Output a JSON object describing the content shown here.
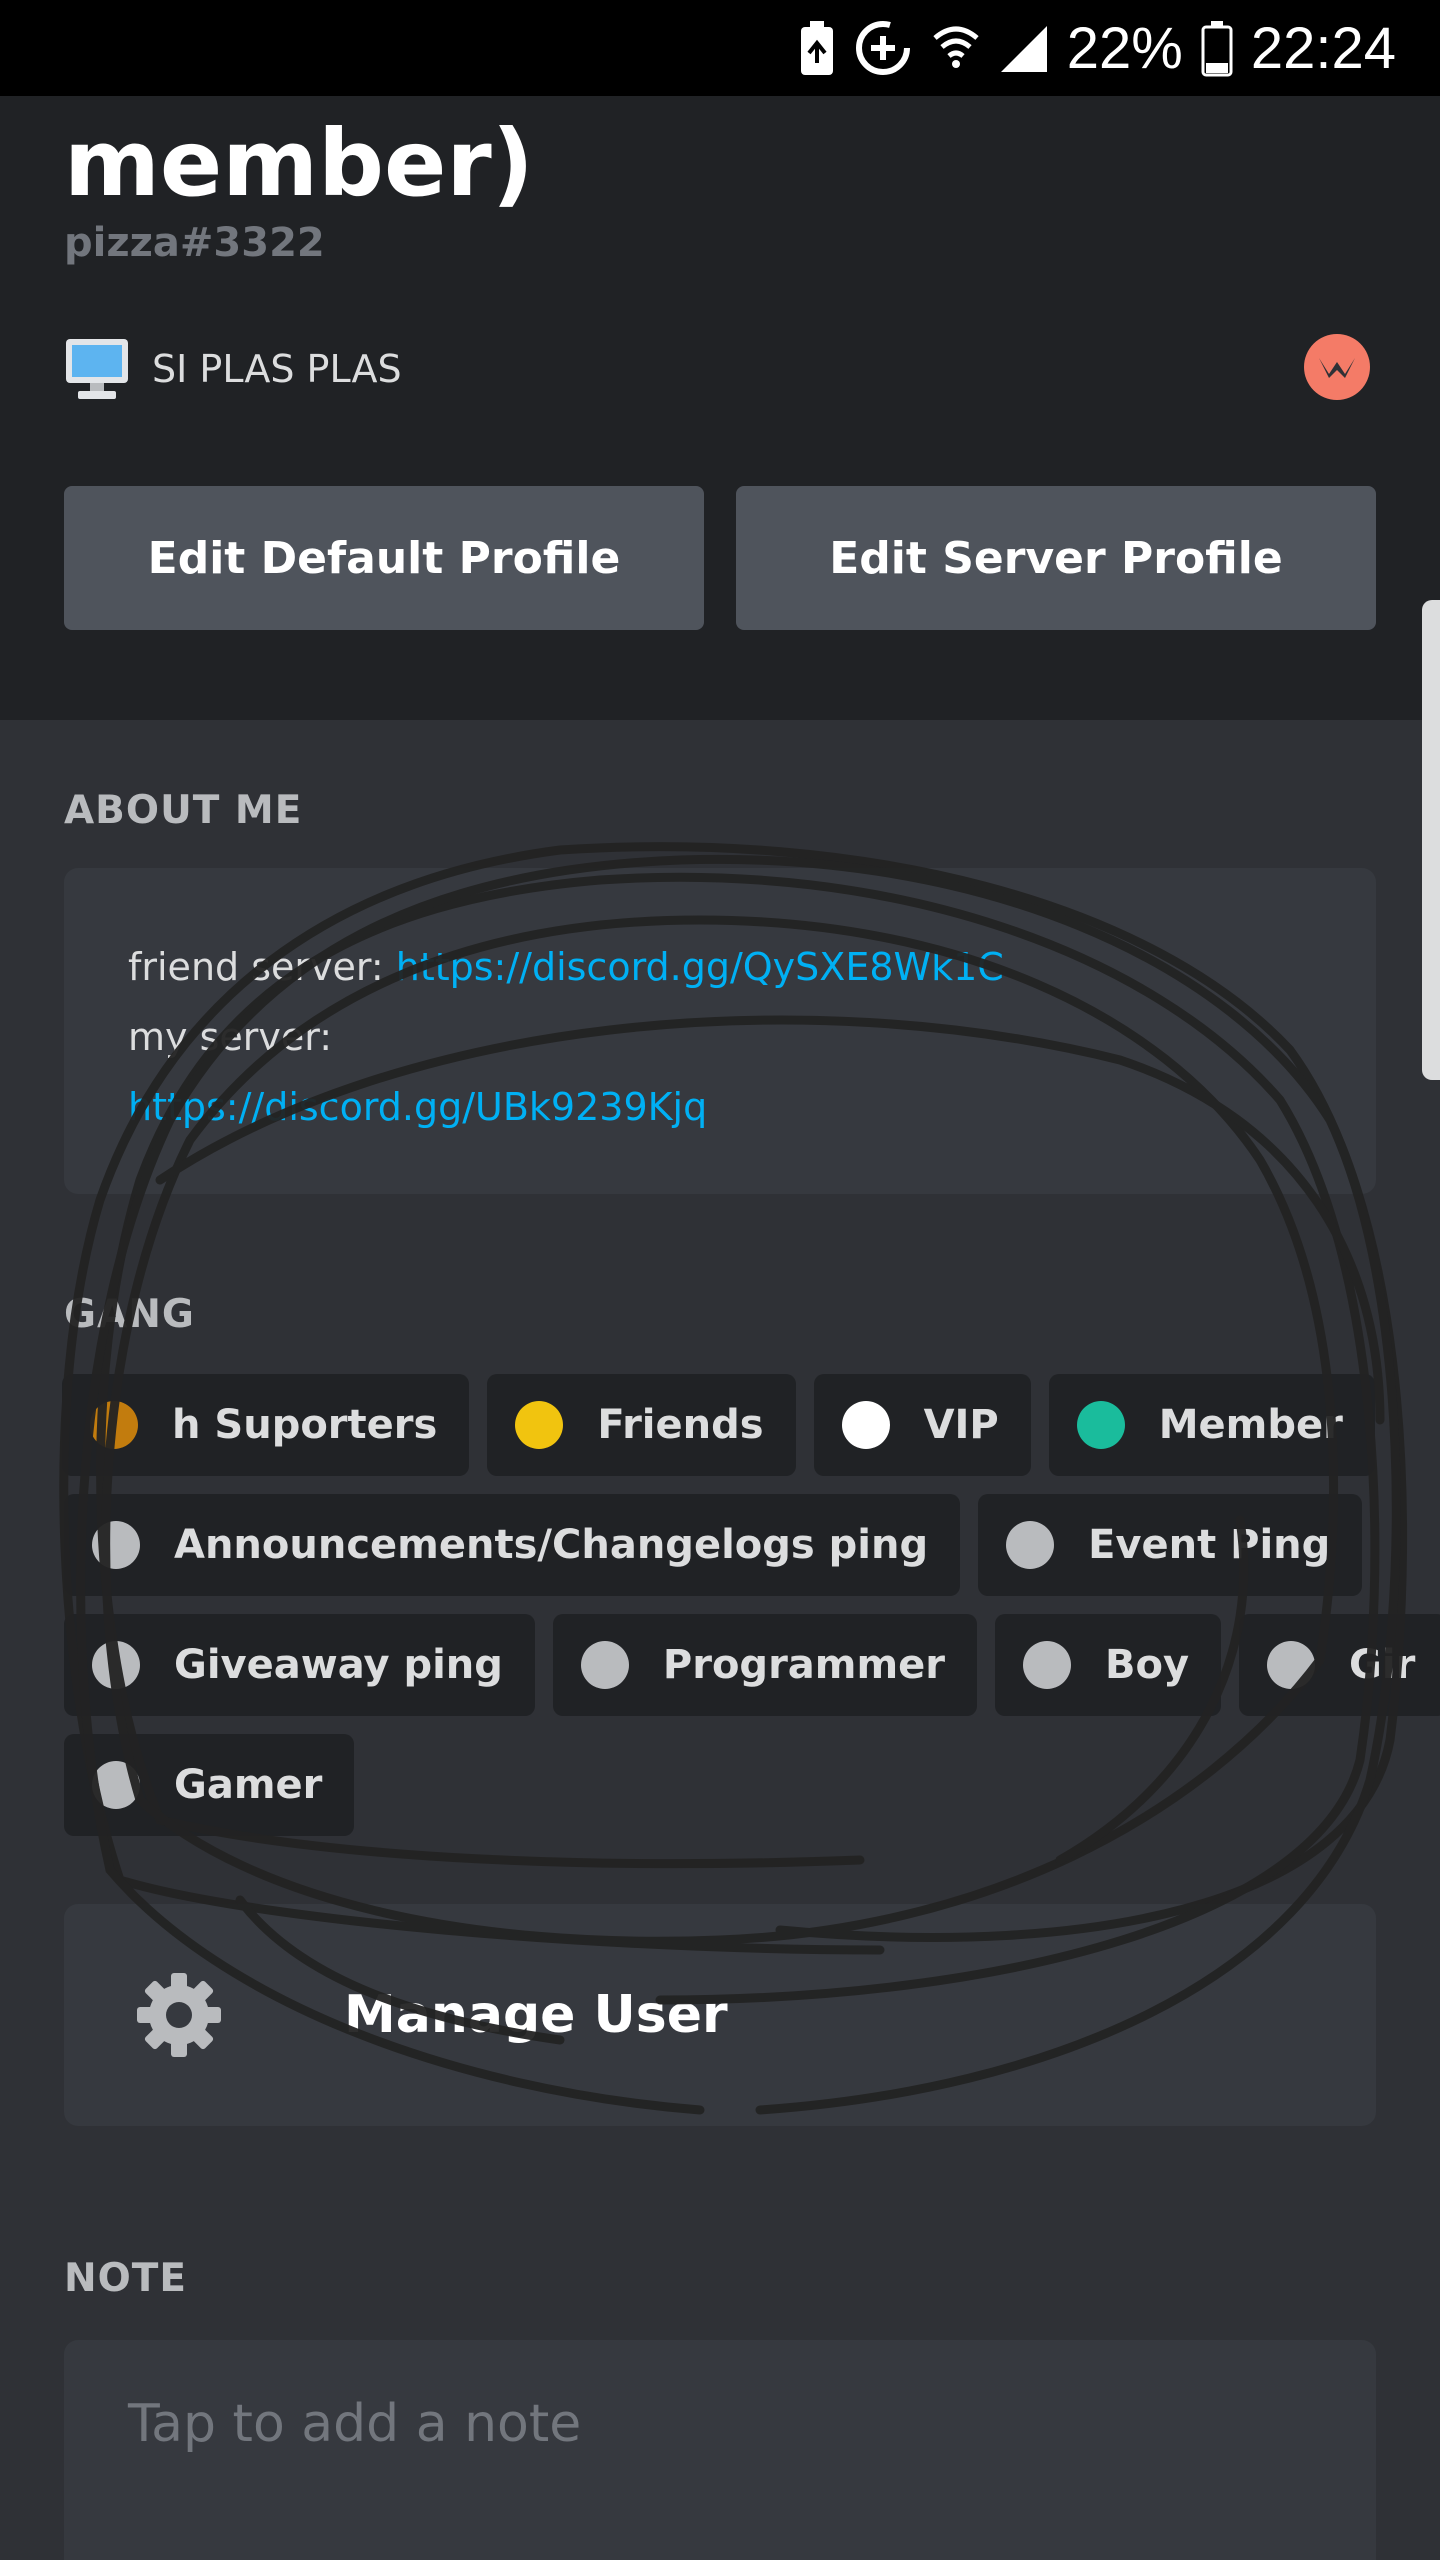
{
  "status_bar": {
    "battery_percent": "22%",
    "time": "22:24",
    "icons": [
      "battery-saver-icon",
      "data-saver-icon",
      "wifi-icon",
      "cellular-signal-icon",
      "battery-icon"
    ]
  },
  "profile": {
    "display_name": "member)",
    "tag": "pizza#3322",
    "activity_text": "SI PLAS PLAS",
    "activity_icon": "desktop-monitor-icon",
    "badge_icon": "bug-hunter-badge-icon",
    "edit_default_label": "Edit Default Profile",
    "edit_server_label": "Edit Server Profile"
  },
  "about": {
    "heading": "ABOUT ME",
    "line1_text": "friend server: ",
    "line1_link": "https://discord.gg/QySXE8Wk1C",
    "line2_text": "my server:",
    "line3_link": "https://discord.gg/UBk9239Kjq"
  },
  "roles": {
    "heading": "GANG",
    "items": [
      {
        "label": "h Suporters",
        "color": "#c27c0e"
      },
      {
        "label": "Friends",
        "color": "#f1c40f"
      },
      {
        "label": "VIP",
        "color": "#ffffff"
      },
      {
        "label": "Member",
        "color": "#1abc9c"
      },
      {
        "label": "Announcements/Changelogs ping",
        "color": "#b9bbbe"
      },
      {
        "label": "Event Ping",
        "color": "#b9bbbe"
      },
      {
        "label": "Giveaway ping",
        "color": "#b9bbbe"
      },
      {
        "label": "Programmer",
        "color": "#b9bbbe"
      },
      {
        "label": "Boy",
        "color": "#b9bbbe"
      },
      {
        "label": "Gir",
        "color": "#b9bbbe"
      },
      {
        "label": "Gamer",
        "color": "#b9bbbe"
      }
    ]
  },
  "manage": {
    "label": "Manage User",
    "icon": "gear-icon"
  },
  "note": {
    "heading": "NOTE",
    "placeholder": "Tap to add a note"
  },
  "colors": {
    "background": "#2f3136",
    "header": "#202225",
    "link": "#00b0f4",
    "button": "#4f545c"
  }
}
